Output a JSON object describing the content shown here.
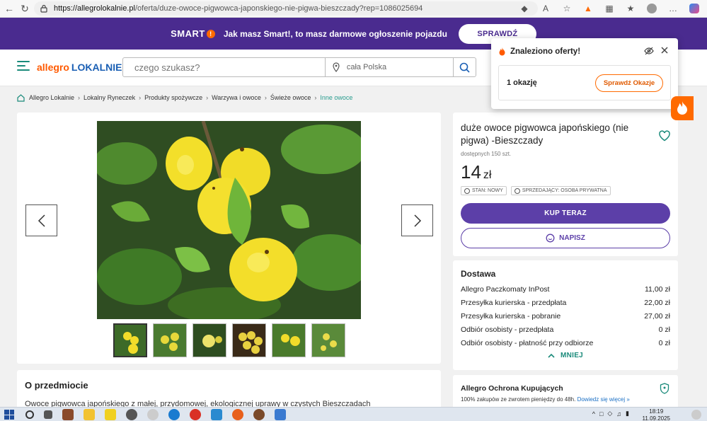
{
  "browser": {
    "url_host": "https://allegrolokalnie.pl",
    "url_path": "/oferta/duze-owoce-pigwowca-japonskiego-nie-pigwa-bieszczady?rep=1086025694"
  },
  "banner": {
    "brand": "SMART",
    "text": "Jak masz Smart!, to masz darmowe ogłoszenie pojazdu",
    "button": "SPRAWDŹ"
  },
  "header": {
    "logo_allegro": "allegro",
    "logo_lokalnie": "LOKALNIE",
    "search_placeholder": "czego szukasz?",
    "location": "cała Polska"
  },
  "breadcrumb": [
    "Allegro Lokalnie",
    "Lokalny Ryneczek",
    "Produkty spożywcze",
    "Warzywa i owoce",
    "Świeże owoce",
    "Inne owoce"
  ],
  "product": {
    "title": "duże owoce pigwowca japońskiego (nie pigwa) -Bieszczady",
    "availability": "dostępnych 150 szt.",
    "price": "14",
    "currency": "zł",
    "tag_condition": "STAN: NOWY",
    "tag_seller": "SPRZEDAJĄCY: OSOBA PRYWATNA",
    "buy_label": "KUP TERAZ",
    "write_label": "NAPISZ"
  },
  "delivery": {
    "title": "Dostawa",
    "rows": [
      {
        "name": "Allegro Paczkomaty InPost",
        "price": "11,00 zł"
      },
      {
        "name": "Przesyłka kurierska - przedpłata",
        "price": "22,00 zł"
      },
      {
        "name": "Przesyłka kurierska - pobranie",
        "price": "27,00 zł"
      },
      {
        "name": "Odbiór osobisty - przedpłata",
        "price": "0 zł"
      },
      {
        "name": "Odbiór osobisty - płatność przy odbiorze",
        "price": "0 zł"
      }
    ],
    "less_label": "MNIEJ"
  },
  "protection": {
    "title": "Allegro Ochrona Kupujących",
    "text": "100% zakupów ze zwrotem pieniędzy do 48h.",
    "link": "Dowiedz się więcej »"
  },
  "about": {
    "title": "O przedmiocie",
    "text": "Owoce pigwowca japońskiego z małej, przydomowej, ekologicznej uprawy w czystych Bieszczadach"
  },
  "popup": {
    "title": "Znaleziono oferty!",
    "count": "1 okazję",
    "button": "Sprawdź Okazje"
  },
  "taskbar": {
    "time": "18:19",
    "date": "11.09.2025"
  },
  "colors": {
    "banner": "#4a2b8f",
    "primary_button": "#5c3fa8",
    "accent_orange": "#ff6a00",
    "teal": "#1a8a7a"
  }
}
